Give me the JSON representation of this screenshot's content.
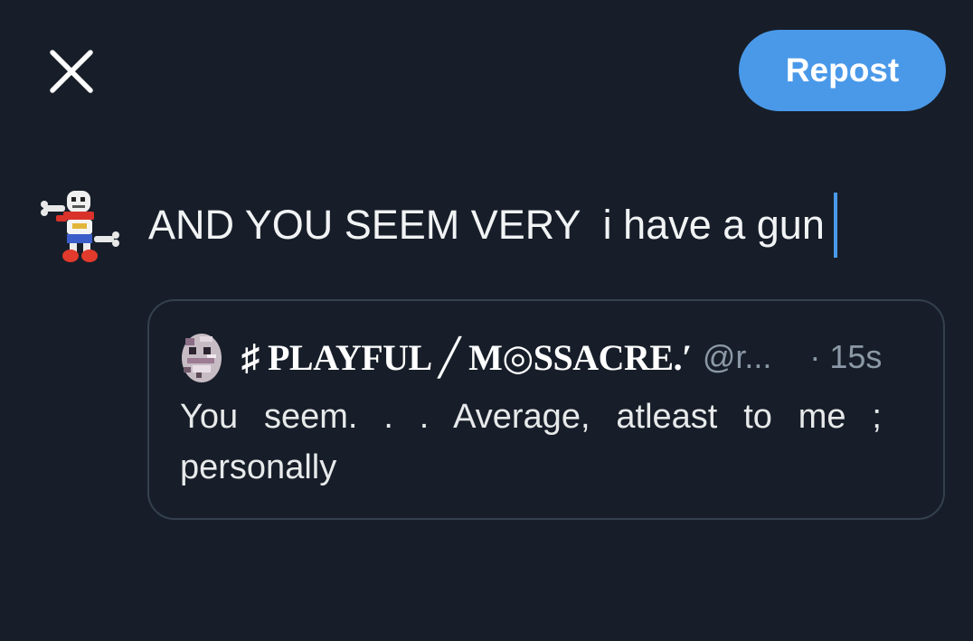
{
  "toolbar": {
    "close_icon": "close-icon",
    "repost_label": "Repost",
    "accent_color": "#4a99e9"
  },
  "composer": {
    "avatar_icon": "papyrus-avatar",
    "text": "AND YOU SEEM VERY  i have a gun"
  },
  "quoted_post": {
    "avatar_icon": "pixel-skull-avatar",
    "display_name": "♯ PLAYFUL ╱ M◎SSACRE.′",
    "handle": "@r...",
    "time": "· 15s",
    "text": "You seem. . . Average, atleast to me ; personally"
  },
  "colors": {
    "background": "#171e29",
    "card_border": "#34404d",
    "secondary_text": "#8b98a5"
  }
}
